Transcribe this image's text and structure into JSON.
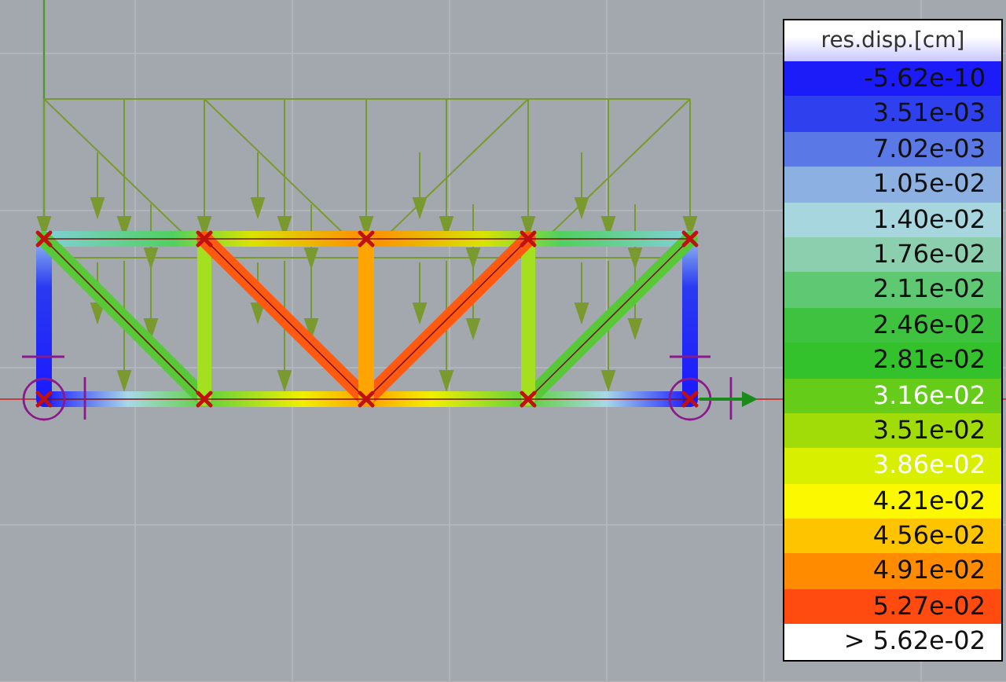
{
  "legend": {
    "title": "res.disp.[cm]",
    "entries": [
      {
        "label": "-5.62e-10",
        "color": "#1c1cf8",
        "kind": "dark"
      },
      {
        "label": "3.51e-03",
        "color": "#2f40ee",
        "kind": "dark"
      },
      {
        "label": "7.02e-03",
        "color": "#5a78e6",
        "kind": "dark"
      },
      {
        "label": "1.05e-02",
        "color": "#8cb0e2",
        "kind": "dark"
      },
      {
        "label": "1.40e-02",
        "color": "#a8d6de",
        "kind": "dark"
      },
      {
        "label": "1.76e-02",
        "color": "#8ccfae",
        "kind": "dark"
      },
      {
        "label": "2.11e-02",
        "color": "#5ec872",
        "kind": "dark"
      },
      {
        "label": "2.46e-02",
        "color": "#3ec240",
        "kind": "dark"
      },
      {
        "label": "2.81e-02",
        "color": "#34c22c",
        "kind": "dark"
      },
      {
        "label": "3.16e-02",
        "color": "#66cc1a",
        "kind": "light"
      },
      {
        "label": "3.51e-02",
        "color": "#a2dc08",
        "kind": "dark"
      },
      {
        "label": "3.86e-02",
        "color": "#d8f000",
        "kind": "light"
      },
      {
        "label": "4.21e-02",
        "color": "#fcf800",
        "kind": "dark"
      },
      {
        "label": "4.56e-02",
        "color": "#ffc400",
        "kind": "dark"
      },
      {
        "label": "4.91e-02",
        "color": "#ff8c00",
        "kind": "dark"
      },
      {
        "label": "5.27e-02",
        "color": "#ff4a10",
        "kind": "dark"
      },
      {
        "label": "> 5.62e-02",
        "color": "#ffffff",
        "kind": "dark"
      }
    ]
  }
}
